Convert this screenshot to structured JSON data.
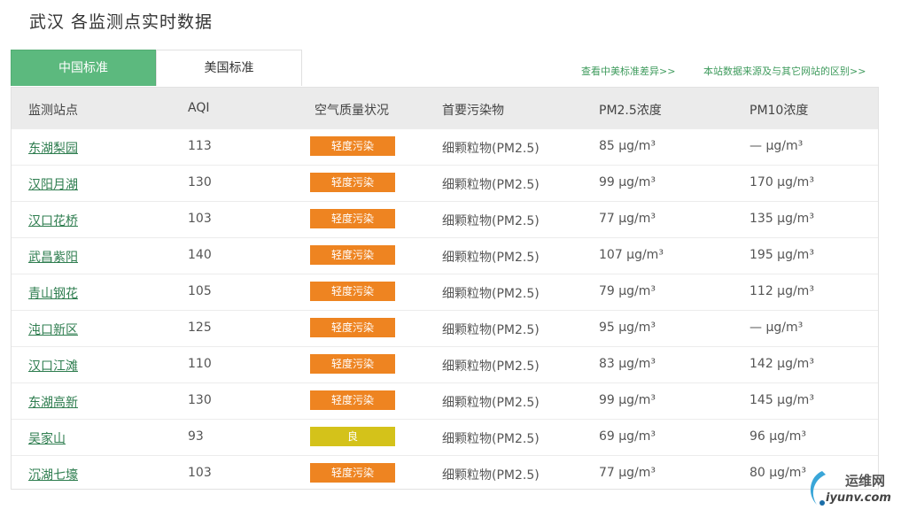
{
  "page": {
    "title": "武汉 各监测点实时数据"
  },
  "tabs": [
    {
      "label": "中国标准",
      "active": true
    },
    {
      "label": "美国标准",
      "active": false
    }
  ],
  "links": {
    "diff": "查看中美标准差异>>",
    "source": "本站数据来源及与其它网站的区别>>"
  },
  "table": {
    "headers": {
      "station": "监测站点",
      "aqi": "AQI",
      "quality": "空气质量状况",
      "pollutant": "首要污染物",
      "pm25": "PM2.5浓度",
      "pm10": "PM10浓度"
    },
    "rows": [
      {
        "station": "东湖梨园",
        "aqi": "113",
        "quality": "轻度污染",
        "pollutant": "细颗粒物(PM2.5)",
        "pm25": "85 μg/m³",
        "pm10": "— μg/m³"
      },
      {
        "station": "汉阳月湖",
        "aqi": "130",
        "quality": "轻度污染",
        "pollutant": "细颗粒物(PM2.5)",
        "pm25": "99 μg/m³",
        "pm10": "170 μg/m³"
      },
      {
        "station": "汉口花桥",
        "aqi": "103",
        "quality": "轻度污染",
        "pollutant": "细颗粒物(PM2.5)",
        "pm25": "77 μg/m³",
        "pm10": "135 μg/m³"
      },
      {
        "station": "武昌紫阳",
        "aqi": "140",
        "quality": "轻度污染",
        "pollutant": "细颗粒物(PM2.5)",
        "pm25": "107 μg/m³",
        "pm10": "195 μg/m³"
      },
      {
        "station": "青山钢花",
        "aqi": "105",
        "quality": "轻度污染",
        "pollutant": "细颗粒物(PM2.5)",
        "pm25": "79 μg/m³",
        "pm10": "112 μg/m³"
      },
      {
        "station": "沌口新区",
        "aqi": "125",
        "quality": "轻度污染",
        "pollutant": "细颗粒物(PM2.5)",
        "pm25": "95 μg/m³",
        "pm10": "— μg/m³"
      },
      {
        "station": "汉口江滩",
        "aqi": "110",
        "quality": "轻度污染",
        "pollutant": "细颗粒物(PM2.5)",
        "pm25": "83 μg/m³",
        "pm10": "142 μg/m³"
      },
      {
        "station": "东湖高新",
        "aqi": "130",
        "quality": "轻度污染",
        "pollutant": "细颗粒物(PM2.5)",
        "pm25": "99 μg/m³",
        "pm10": "145 μg/m³"
      },
      {
        "station": "吴家山",
        "aqi": "93",
        "quality": "良",
        "pollutant": "细颗粒物(PM2.5)",
        "pm25": "69 μg/m³",
        "pm10": "96 μg/m³"
      },
      {
        "station": "沉湖七壕",
        "aqi": "103",
        "quality": "轻度污染",
        "pollutant": "细颗粒物(PM2.5)",
        "pm25": "77 μg/m³",
        "pm10": "80 μg/m³"
      }
    ]
  },
  "colors": {
    "light_pollution": "#ee8421",
    "good": "#d4c21a",
    "tab_active": "#5cb97e",
    "link": "#3f9b5d"
  },
  "watermark": {
    "cn": "运维网",
    "domain": "iyunv.com",
    "icon": "swoosh-logo-icon"
  }
}
